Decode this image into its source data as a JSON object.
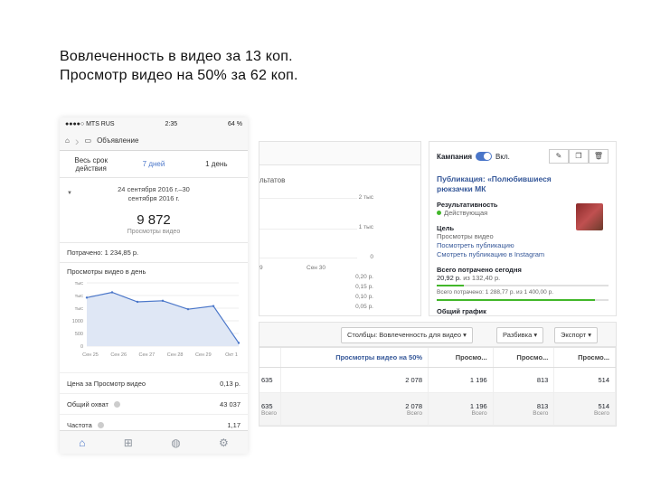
{
  "headline": {
    "line1": "Вовлеченность в видео за 13 коп.",
    "line2": "Просмотр видео на 50% за 62 коп."
  },
  "phone": {
    "status": {
      "carrier": "●●●●○ MTS RUS",
      "time": "2:35",
      "battery": "64 %"
    },
    "nav": {
      "title": "Объявление"
    },
    "tabs": [
      {
        "label": "Весь срок действия"
      },
      {
        "label": "7 дней"
      },
      {
        "label": "1 день"
      }
    ],
    "date_range_line1": "24 сентября 2016 г.–30",
    "date_range_line2": "сентября 2016 г.",
    "views_value": "9 872",
    "views_label": "Просмотры видео",
    "spent": "Потрачено: 1 234,85 p.",
    "chart_title": "Просмотры видео в день",
    "metrics": [
      {
        "label": "Цена за Просмотр видео",
        "value": "0,13 р."
      },
      {
        "label": "Общий охват",
        "value": "43 037"
      },
      {
        "label": "Частота",
        "value": "1,17"
      }
    ]
  },
  "chart_data": {
    "type": "area",
    "title": "Просмотры видео в день",
    "categories": [
      "Сен 25",
      "Сен 26",
      "Сен 27",
      "Сен 28",
      "Сен 29",
      "Окт 1"
    ],
    "y_ticks": [
      "тыс",
      "тыс",
      "тыс",
      "1000",
      "500",
      "0"
    ],
    "values": [
      2300,
      2550,
      2100,
      2150,
      1750,
      1900,
      150
    ],
    "color": "#4a76c9"
  },
  "ads": {
    "left_panel": {
      "title_fragment": "льтатов",
      "axis_right": [
        "2 тыс",
        "1 тыс",
        "0",
        "0,20 р.",
        "0,15 р.",
        "0,10 р.",
        "0,05 р."
      ],
      "axis_bottom": [
        "9",
        "Сен 30"
      ]
    },
    "right_panel": {
      "campaign_label": "Кампания",
      "toggle_label": "Вкл.",
      "publication": "Публикация: «Полюбившиеся рюкзачки МК",
      "result_label": "Результативность",
      "result_value": "Действующая",
      "goal_label": "Цель",
      "goal_value": "Просмотры видео",
      "link1": "Посмотреть публикацию",
      "link2": "Смотреть публикацию в Instagram",
      "spent_today_label": "Всего потрачено сегодня",
      "spent_today_value": "20,92 р.",
      "spent_today_of": "из 132,40 р.",
      "spent_total": "Всего потрачено: 1 288,77 р. из 1 400,00 р.",
      "general_chart": "Общий график"
    },
    "toolbar": {
      "columns_label": "Столбцы: Вовлеченность для видео",
      "breakdown_label": "Разбивка",
      "export_label": "Экспорт"
    },
    "table": {
      "headers": [
        "",
        "Просмотры видео на 50%",
        "Просмо...",
        "Просмо...",
        "Просмо..."
      ],
      "row": [
        "635",
        "2 078",
        "1 196",
        "813",
        "514"
      ],
      "total": [
        "635",
        "2 078",
        "1 196",
        "813",
        "514"
      ],
      "total_sub": "Всего"
    }
  }
}
